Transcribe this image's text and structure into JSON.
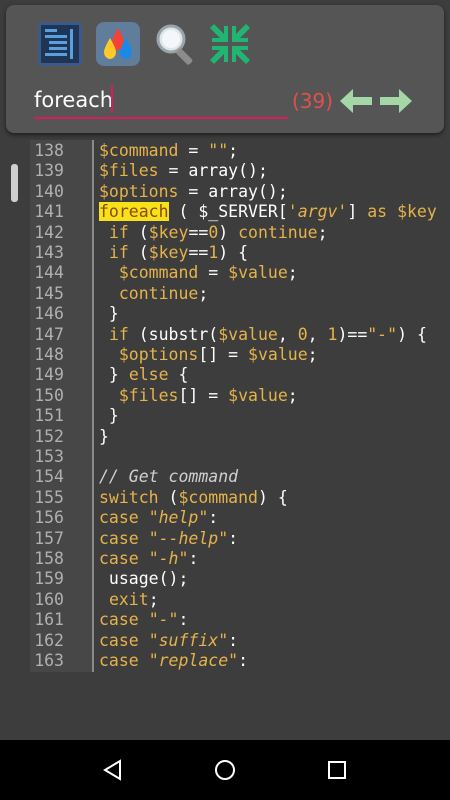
{
  "toolbar": {
    "icons": [
      "outline-icon",
      "theme-colors-icon",
      "search-icon",
      "collapse-icon"
    ]
  },
  "search": {
    "query": "foreach",
    "match_count": "(39)"
  },
  "code": {
    "lines": [
      {
        "n": "138",
        "t": [
          [
            "var",
            "$command"
          ],
          [
            "p",
            " = "
          ],
          [
            "str",
            "\"\""
          ],
          [
            "p",
            ";"
          ]
        ]
      },
      {
        "n": "139",
        "t": [
          [
            "var",
            "$files"
          ],
          [
            "p",
            " = array();"
          ]
        ]
      },
      {
        "n": "140",
        "t": [
          [
            "var",
            "$options"
          ],
          [
            "p",
            " = array();"
          ]
        ]
      },
      {
        "n": "141",
        "t": [
          [
            "hl",
            "foreach"
          ],
          [
            "p",
            " ( $_SERVER["
          ],
          [
            "str",
            "'argv'"
          ],
          [
            "p",
            "] "
          ],
          [
            "kw",
            "as"
          ],
          [
            "p",
            " "
          ],
          [
            "var",
            "$key"
          ]
        ]
      },
      {
        "n": "142",
        "t": [
          [
            "p",
            " "
          ],
          [
            "kw",
            "if"
          ],
          [
            "p",
            " ("
          ],
          [
            "var",
            "$key"
          ],
          [
            "p",
            "=="
          ],
          [
            "num",
            "0"
          ],
          [
            "p",
            ") "
          ],
          [
            "kw",
            "continue"
          ],
          [
            "p",
            ";"
          ]
        ]
      },
      {
        "n": "143",
        "t": [
          [
            "p",
            " "
          ],
          [
            "kw",
            "if"
          ],
          [
            "p",
            " ("
          ],
          [
            "var",
            "$key"
          ],
          [
            "p",
            "=="
          ],
          [
            "num",
            "1"
          ],
          [
            "p",
            ") {"
          ]
        ]
      },
      {
        "n": "144",
        "t": [
          [
            "p",
            "  "
          ],
          [
            "var",
            "$command"
          ],
          [
            "p",
            " = "
          ],
          [
            "var",
            "$value"
          ],
          [
            "p",
            ";"
          ]
        ]
      },
      {
        "n": "145",
        "t": [
          [
            "p",
            "  "
          ],
          [
            "kw",
            "continue"
          ],
          [
            "p",
            ";"
          ]
        ]
      },
      {
        "n": "146",
        "t": [
          [
            "p",
            " }"
          ]
        ]
      },
      {
        "n": "147",
        "t": [
          [
            "p",
            " "
          ],
          [
            "kw",
            "if"
          ],
          [
            "p",
            " (substr("
          ],
          [
            "var",
            "$value"
          ],
          [
            "p",
            ", "
          ],
          [
            "num",
            "0"
          ],
          [
            "p",
            ", "
          ],
          [
            "num",
            "1"
          ],
          [
            "p",
            ")=="
          ],
          [
            "str",
            "\"-\""
          ],
          [
            "p",
            ") {"
          ]
        ]
      },
      {
        "n": "148",
        "t": [
          [
            "p",
            "  "
          ],
          [
            "var",
            "$options"
          ],
          [
            "p",
            "[] = "
          ],
          [
            "var",
            "$value"
          ],
          [
            "p",
            ";"
          ]
        ]
      },
      {
        "n": "149",
        "t": [
          [
            "p",
            " } "
          ],
          [
            "kw",
            "else"
          ],
          [
            "p",
            " {"
          ]
        ]
      },
      {
        "n": "150",
        "t": [
          [
            "p",
            "  "
          ],
          [
            "var",
            "$files"
          ],
          [
            "p",
            "[] = "
          ],
          [
            "var",
            "$value"
          ],
          [
            "p",
            ";"
          ]
        ]
      },
      {
        "n": "151",
        "t": [
          [
            "p",
            " }"
          ]
        ]
      },
      {
        "n": "152",
        "t": [
          [
            "p",
            "}"
          ]
        ]
      },
      {
        "n": "153",
        "t": []
      },
      {
        "n": "154",
        "t": [
          [
            "cmt",
            "// Get command"
          ]
        ]
      },
      {
        "n": "155",
        "t": [
          [
            "kw",
            "switch"
          ],
          [
            "p",
            " ("
          ],
          [
            "var",
            "$command"
          ],
          [
            "p",
            ") {"
          ]
        ]
      },
      {
        "n": "156",
        "t": [
          [
            "kw",
            "case"
          ],
          [
            "p",
            " "
          ],
          [
            "str",
            "\"help\""
          ],
          [
            "p",
            ":"
          ]
        ]
      },
      {
        "n": "157",
        "t": [
          [
            "kw",
            "case"
          ],
          [
            "p",
            " "
          ],
          [
            "str",
            "\"--help\""
          ],
          [
            "p",
            ":"
          ]
        ]
      },
      {
        "n": "158",
        "t": [
          [
            "kw",
            "case"
          ],
          [
            "p",
            " "
          ],
          [
            "str",
            "\"-h\""
          ],
          [
            "p",
            ":"
          ]
        ]
      },
      {
        "n": "159",
        "t": [
          [
            "p",
            " usage();"
          ]
        ]
      },
      {
        "n": "160",
        "t": [
          [
            "p",
            " "
          ],
          [
            "kw",
            "exit"
          ],
          [
            "p",
            ";"
          ]
        ]
      },
      {
        "n": "161",
        "t": [
          [
            "kw",
            "case"
          ],
          [
            "p",
            " "
          ],
          [
            "str",
            "\"-\""
          ],
          [
            "p",
            ":"
          ]
        ]
      },
      {
        "n": "162",
        "t": [
          [
            "kw",
            "case"
          ],
          [
            "p",
            " "
          ],
          [
            "str",
            "\"suffix\""
          ],
          [
            "p",
            ":"
          ]
        ]
      },
      {
        "n": "163",
        "t": [
          [
            "kw",
            "case"
          ],
          [
            "p",
            " "
          ],
          [
            "str",
            "\"replace\""
          ],
          [
            "p",
            ":"
          ]
        ]
      }
    ]
  },
  "nav": {
    "icons": [
      "back-icon",
      "home-icon",
      "recents-icon"
    ]
  },
  "colors": {
    "accent": "#d81b60",
    "match_count": "#e0504c",
    "arrows": "#a5d6a7",
    "keyword": "#e6b34a",
    "highlight": "#f6e11a"
  }
}
